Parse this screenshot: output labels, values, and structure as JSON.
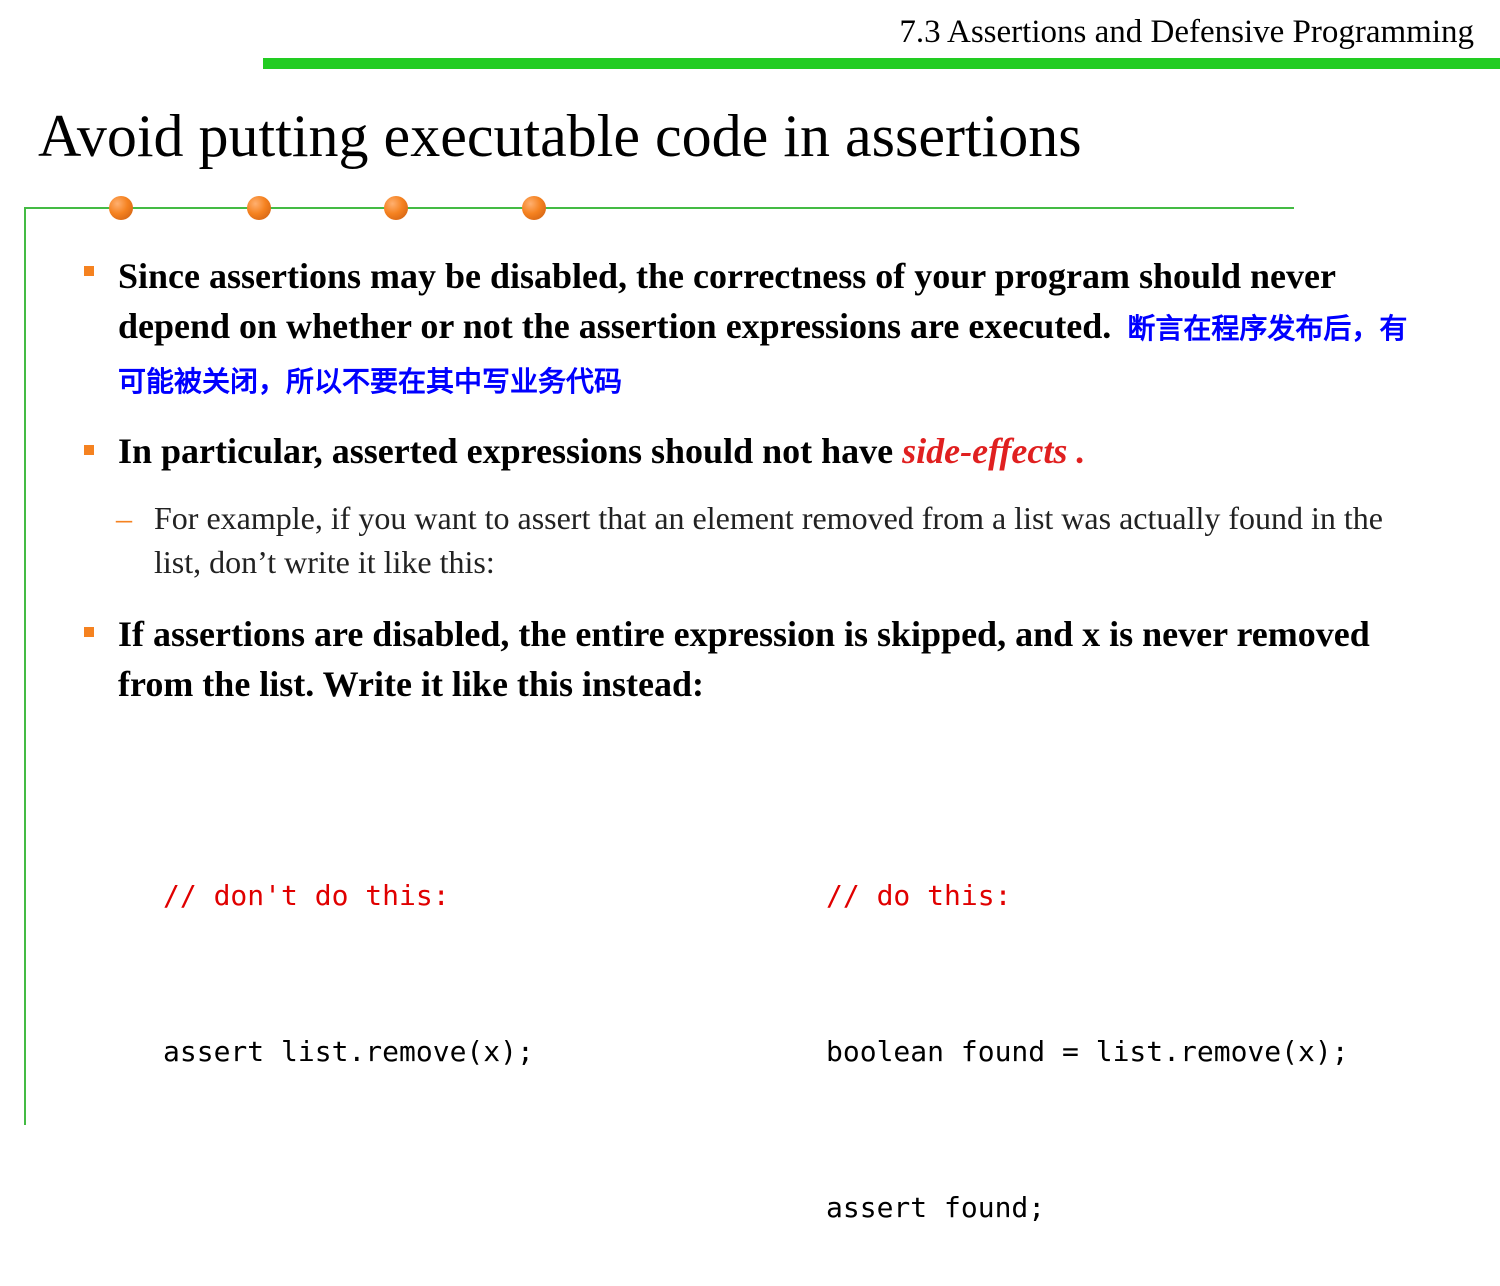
{
  "header": {
    "section_title": "7.3 Assertions and Defensive Programming"
  },
  "slide": {
    "title": "Avoid putting executable code in assertions"
  },
  "bullets": [
    {
      "text": "Since assertions may be disabled, the correctness of your program should never depend on whether or not the assertion expressions are executed.",
      "note_cn": "断言在程序发布后，有可能被关闭，所以不要在其中写业务代码"
    },
    {
      "text": "In particular, asserted expressions should not have",
      "highlight": "side-effects ."
    },
    {
      "text": "If assertions are disabled, the entire expression is skipped, and x is never removed from the list. Write it like this instead:"
    }
  ],
  "sub_bullet": {
    "marker": "–",
    "text": "For example, if you want to assert that an element removed from a list was actually found in the list, don’t write it like this:"
  },
  "code": {
    "bad": {
      "comment": "// don't do this:",
      "lines": [
        "assert list.remove(x);"
      ]
    },
    "good": {
      "comment": "// do this:",
      "lines": [
        "boolean found = list.remove(x);",
        "assert found;"
      ]
    }
  },
  "colors": {
    "header_bar": "#22cc22",
    "frame": "#44bb44",
    "bullet": "#f58220",
    "chinese_note": "#0000ff",
    "highlight": "#e02020",
    "code_comment": "#e00000"
  }
}
